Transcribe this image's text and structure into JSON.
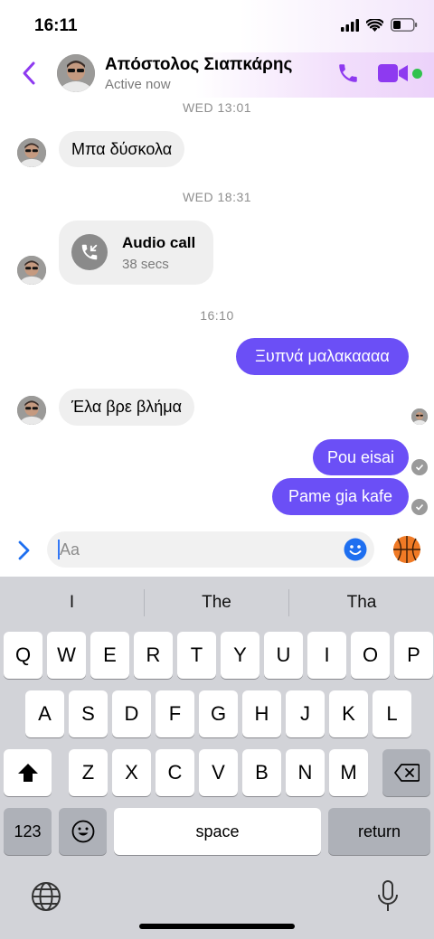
{
  "status_bar": {
    "time": "16:11"
  },
  "header": {
    "contact_name": "Απόστολος Σιαπκάρης",
    "status": "Active now",
    "accent": "#8e3af0",
    "online_color": "#31c24d"
  },
  "messages": {
    "ts1": "WED 13:01",
    "m1": "Μπα δύσκολα",
    "ts2": "WED 18:31",
    "call_title": "Audio call",
    "call_duration": "38 secs",
    "ts3": "16:10",
    "m2": "Ξυπνά μαλακαααα",
    "m3": "Έλα βρε βλήμα",
    "m4": "Pou eisai",
    "m5": "Pame gia kafe",
    "bubble_out_color": "#6b4ff6",
    "bubble_in_color": "#efefef"
  },
  "composer": {
    "placeholder": "Aa"
  },
  "keyboard": {
    "suggestions": [
      "I",
      "The",
      "Tha"
    ],
    "row1": [
      "Q",
      "W",
      "E",
      "R",
      "T",
      "Y",
      "U",
      "I",
      "O",
      "P"
    ],
    "row2": [
      "A",
      "S",
      "D",
      "F",
      "G",
      "H",
      "J",
      "K",
      "L"
    ],
    "row3": [
      "Z",
      "X",
      "C",
      "V",
      "B",
      "N",
      "M"
    ],
    "numbers_label": "123",
    "space_label": "space",
    "return_label": "return"
  }
}
